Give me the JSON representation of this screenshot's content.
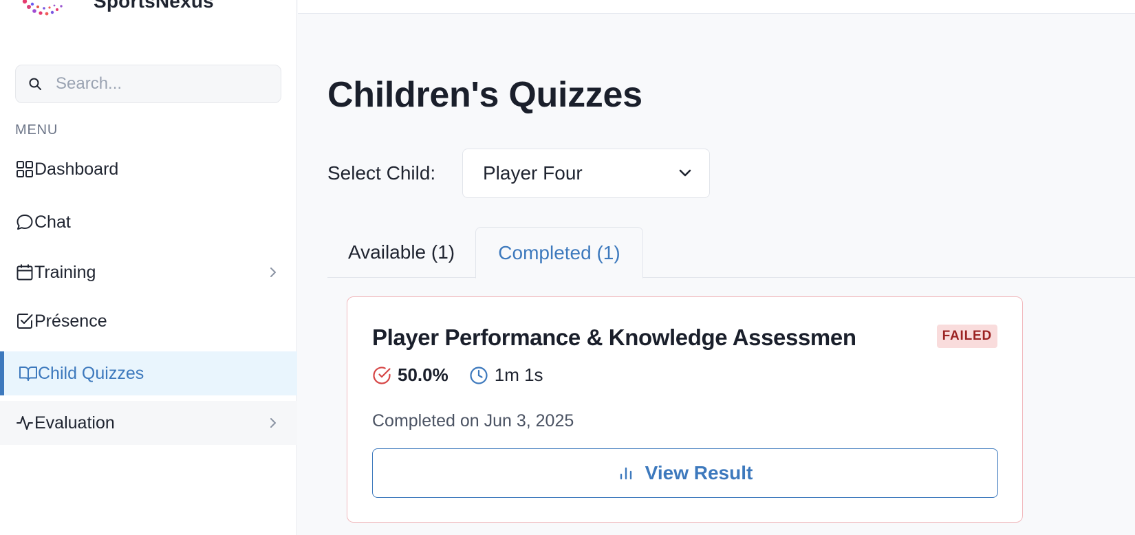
{
  "app": {
    "brand": "SportsNexus",
    "accent_color": "#3d79bd",
    "danger_color": "#d64545"
  },
  "sidebar": {
    "search_placeholder": "Search...",
    "menu_label": "MENU",
    "items": [
      {
        "label": "Dashboard",
        "icon": "grid-icon"
      },
      {
        "label": "Chat",
        "icon": "chat-bubble-icon"
      },
      {
        "label": "Training",
        "icon": "calendar-icon",
        "has_submenu": true
      },
      {
        "label": "Présence",
        "icon": "checkbox-icon"
      },
      {
        "label": "Child Quizzes",
        "icon": "book-open-icon",
        "active": true
      },
      {
        "label": "Evaluation",
        "icon": "activity-icon",
        "has_submenu": true
      }
    ]
  },
  "main": {
    "title": "Children's Quizzes",
    "select_label": "Select Child:",
    "selected_child": "Player Four",
    "tabs": [
      {
        "label": "Available (1)"
      },
      {
        "label": "Completed (1)",
        "active": true
      }
    ],
    "quiz_card": {
      "title": "Player Performance & Knowledge Assessmen",
      "status": "FAILED",
      "score": "50.0%",
      "duration": "1m 1s",
      "completed_on": "Completed on Jun 3, 2025",
      "button_label": "View Result"
    }
  }
}
